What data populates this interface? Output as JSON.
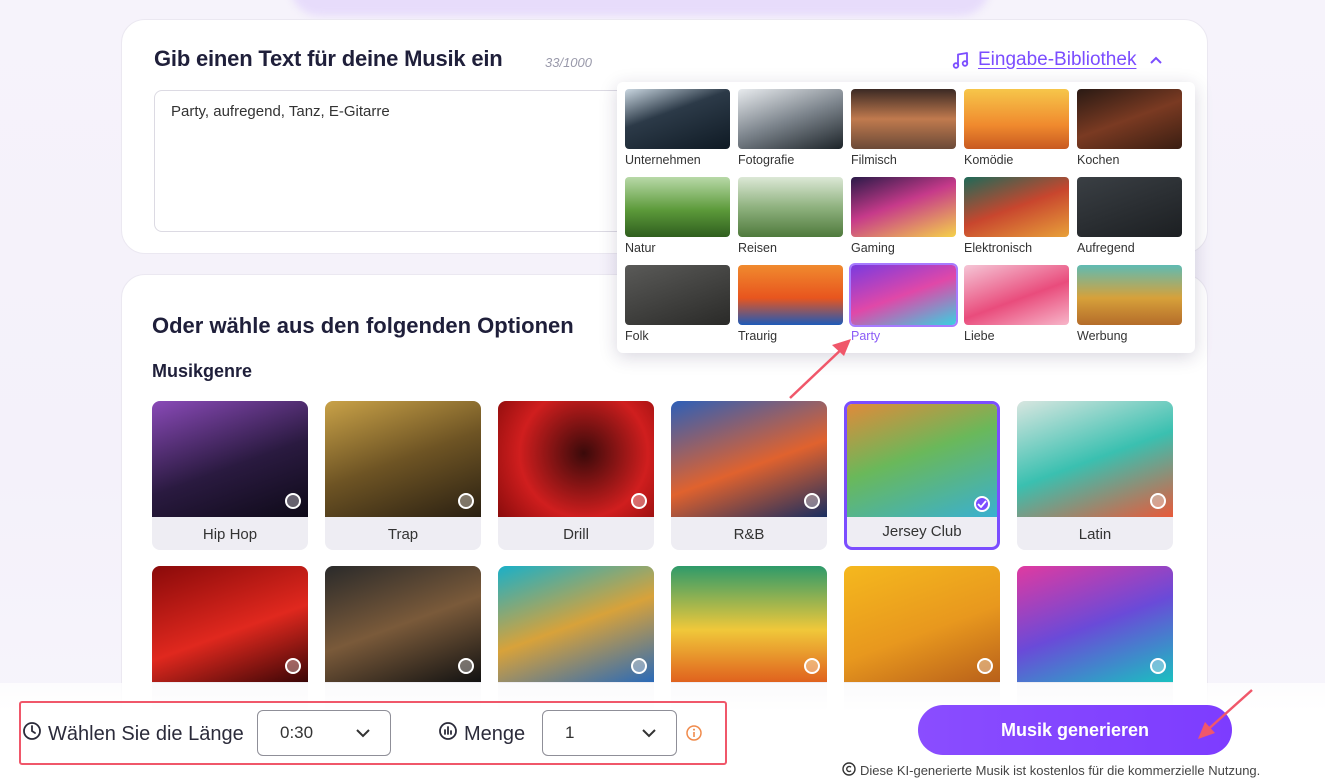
{
  "text_card": {
    "title": "Gib einen Text für deine Musik ein",
    "counter": "33/1000",
    "input_value": "Party, aufregend, Tanz, E-Gitarre",
    "library_label": "Eingabe-Bibliothek"
  },
  "library": {
    "items": [
      {
        "label": "Unternehmen",
        "active": false
      },
      {
        "label": "Fotografie",
        "active": false
      },
      {
        "label": "Filmisch",
        "active": false
      },
      {
        "label": "Komödie",
        "active": false
      },
      {
        "label": "Kochen",
        "active": false
      },
      {
        "label": "Natur",
        "active": false
      },
      {
        "label": "Reisen",
        "active": false
      },
      {
        "label": "Gaming",
        "active": false
      },
      {
        "label": "Elektronisch",
        "active": false
      },
      {
        "label": "Aufregend",
        "active": false
      },
      {
        "label": "Folk",
        "active": false
      },
      {
        "label": "Traurig",
        "active": false
      },
      {
        "label": "Party",
        "active": true
      },
      {
        "label": "Liebe",
        "active": false
      },
      {
        "label": "Werbung",
        "active": false
      }
    ]
  },
  "options_card": {
    "title": "Oder wähle aus den folgenden Optionen",
    "genre_heading": "Musikgenre",
    "genres": [
      {
        "label": "Hip Hop",
        "selected": false
      },
      {
        "label": "Trap",
        "selected": false
      },
      {
        "label": "Drill",
        "selected": false
      },
      {
        "label": "R&B",
        "selected": false
      },
      {
        "label": "Jersey Club",
        "selected": true
      },
      {
        "label": "Latin",
        "selected": false
      },
      {
        "label": "",
        "selected": false
      },
      {
        "label": "",
        "selected": false
      },
      {
        "label": "",
        "selected": false
      },
      {
        "label": "",
        "selected": false
      },
      {
        "label": "",
        "selected": false
      },
      {
        "label": "",
        "selected": false
      }
    ]
  },
  "bottom": {
    "length_label": "Wählen Sie die Länge",
    "length_value": "0:30",
    "amount_label": "Menge",
    "amount_value": "1",
    "generate_label": "Musik generieren",
    "license_text": "Diese KI-generierte Musik ist kostenlos für die kommerzielle Nutzung."
  },
  "colors": {
    "accent": "#7b4dff",
    "annotation": "#f0576a"
  }
}
